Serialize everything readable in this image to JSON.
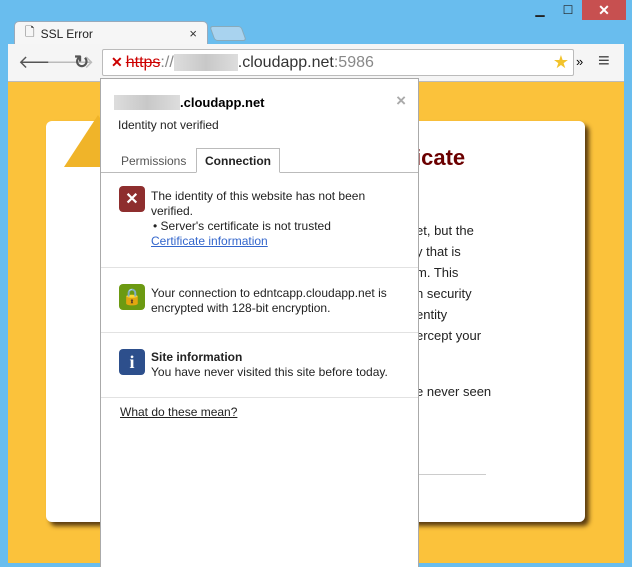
{
  "window": {
    "controls": [
      "minimize",
      "maximize",
      "close"
    ]
  },
  "tab": {
    "title": "SSL Error",
    "close": "×"
  },
  "toolbar": {
    "url_scheme": "https",
    "url_sep": "://",
    "url_host": ".cloudapp.net",
    "url_port": ":5986",
    "extensions": "»"
  },
  "page": {
    "title_fragment": "icate",
    "lines": [
      "et, but the",
      "y that is",
      "m. This",
      "n security",
      "entity",
      "ercept your",
      "e never seen"
    ]
  },
  "popup": {
    "host": ".cloudapp.net",
    "identity": "Identity not verified",
    "close": "×",
    "tabs": [
      {
        "label": "Permissions",
        "active": false
      },
      {
        "label": "Connection",
        "active": true
      }
    ],
    "identity_section": {
      "text": "The identity of this website has not been verified.",
      "bullet": "• Server's certificate is not trusted",
      "link": "Certificate information"
    },
    "encryption_section": {
      "text": "Your connection to edntcapp.cloudapp.net is encrypted with 128-bit encryption."
    },
    "site_section": {
      "title": "Site information",
      "text": "You have never visited this site before today."
    },
    "help_link": "What do these mean?"
  },
  "colors": {
    "frame": "#69bdee",
    "page_bg": "#fbc23b",
    "title": "#6b0000",
    "link": "#3366cc"
  }
}
